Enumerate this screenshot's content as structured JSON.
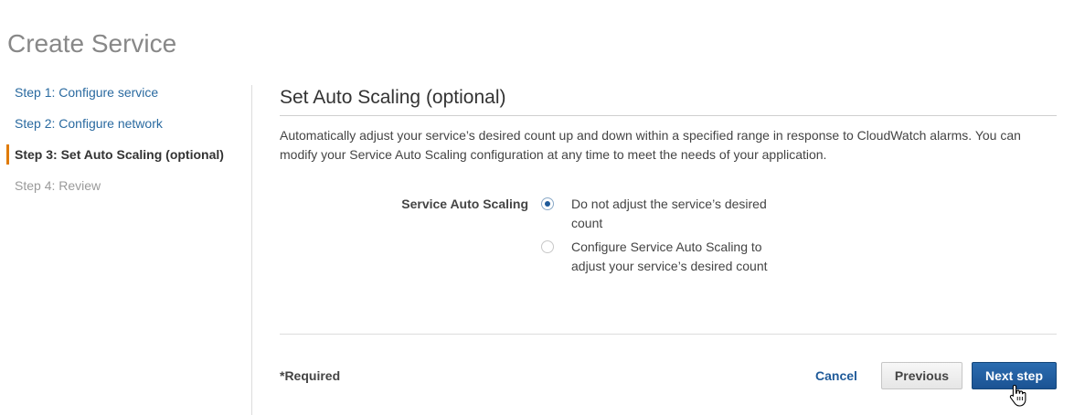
{
  "page": {
    "title": "Create Service"
  },
  "steps": [
    {
      "label": "Step 1: Configure service",
      "state": "link"
    },
    {
      "label": "Step 2: Configure network",
      "state": "link"
    },
    {
      "label": "Step 3: Set Auto Scaling (optional)",
      "state": "active"
    },
    {
      "label": "Step 4: Review",
      "state": "disabled"
    }
  ],
  "section": {
    "title": "Set Auto Scaling (optional)",
    "description": "Automatically adjust your service’s desired count up and down within a specified range in response to CloudWatch alarms. You can modify your Service Auto Scaling configuration at any time to meet the needs of your application."
  },
  "auto_scaling": {
    "label": "Service Auto Scaling",
    "options": [
      {
        "label": "Do not adjust the service’s desired count",
        "selected": true
      },
      {
        "label": "Configure Service Auto Scaling to adjust your service’s desired count",
        "selected": false
      }
    ]
  },
  "footer": {
    "required_note": "*Required",
    "cancel_label": "Cancel",
    "previous_label": "Previous",
    "next_label": "Next step"
  },
  "colors": {
    "active_step_marker": "#e07b00",
    "link": "#2a6aa0",
    "primary_button": "#1b5393"
  },
  "icons": {
    "cursor": "hand-pointer-icon"
  }
}
